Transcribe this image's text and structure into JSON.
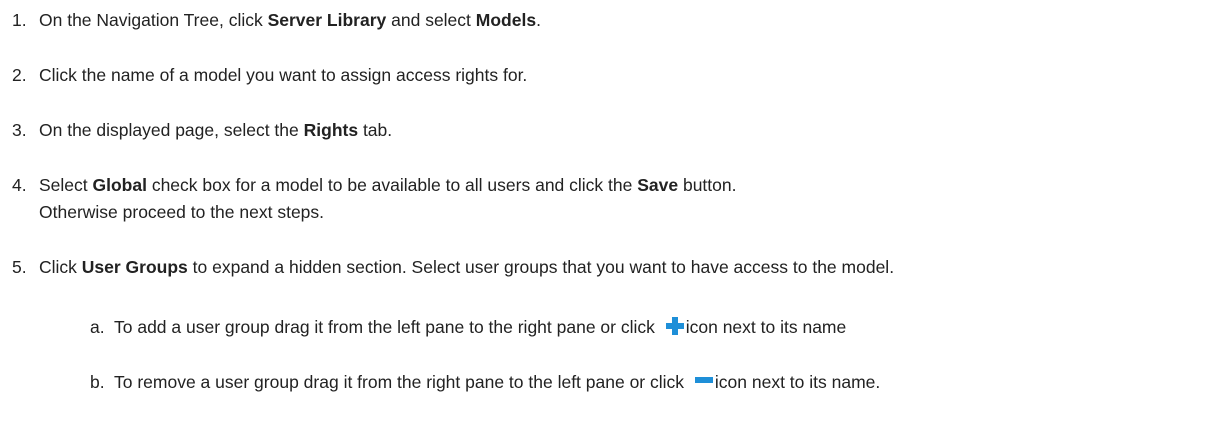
{
  "steps": [
    {
      "num": "1.",
      "parts": [
        "On the Navigation Tree, click ",
        "Server Library",
        " and select ",
        "Models",
        "."
      ]
    },
    {
      "num": "2.",
      "parts": [
        "Click the name of a model you want to assign access rights for."
      ]
    },
    {
      "num": "3.",
      "parts": [
        "On the displayed page, select the ",
        "Rights",
        " tab."
      ]
    },
    {
      "num": "4.",
      "parts": [
        "Select ",
        "Global",
        " check box for a model to be available to all users and click the ",
        "Save",
        " button."
      ],
      "continuation": "Otherwise proceed to the next steps."
    },
    {
      "num": "5.",
      "parts": [
        "Click ",
        "User Groups",
        " to expand a hidden section. Select user groups that you want to have access to the model."
      ]
    }
  ],
  "substeps": [
    {
      "letter": "a.",
      "before": "To add a user group drag it from the left pane to the right pane or click ",
      "icon": "plus-icon",
      "after": "icon next to its name"
    },
    {
      "letter": "b.",
      "before": "To remove a user group drag it from the right pane to the left  pane or click ",
      "icon": "minus-icon",
      "after": "icon next to its name."
    }
  ],
  "colors": {
    "icon_blue": "#1e8fd8",
    "text": "#222222"
  }
}
